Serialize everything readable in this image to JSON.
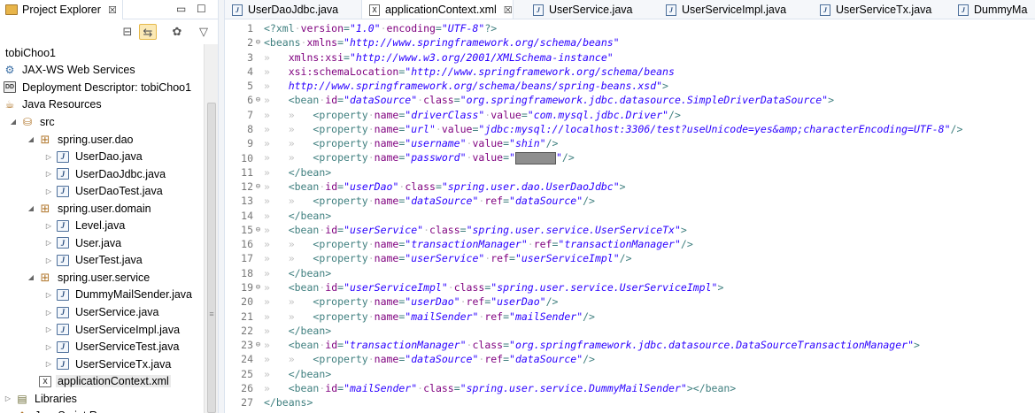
{
  "explorer": {
    "title": "Project Explorer",
    "close_glyph": "☒",
    "minimize_glyph": "▭",
    "maximize_glyph": "☐",
    "toolbar": {
      "collapse_all_glyph": "⊟",
      "link_editor_glyph": "⇆",
      "focus_glyph": "✿",
      "view_menu_glyph": "▽"
    },
    "tree": [
      {
        "label": "tobiChoo1",
        "depth": 0,
        "twisty": "",
        "icon": "project-icon"
      },
      {
        "label": "JAX-WS Web Services",
        "depth": 0,
        "twisty": "",
        "icon": "web-services-icon"
      },
      {
        "label": "Deployment Descriptor: tobiChoo1",
        "depth": 0,
        "twisty": "",
        "icon": "deployment-descriptor-icon"
      },
      {
        "label": "Java Resources",
        "depth": 0,
        "twisty": "",
        "icon": "java-resources-icon"
      },
      {
        "label": "src",
        "depth": 1,
        "twisty": "◢",
        "icon": "source-folder-icon"
      },
      {
        "label": "spring.user.dao",
        "depth": 2,
        "twisty": "◢",
        "icon": "package-icon"
      },
      {
        "label": "UserDao.java",
        "depth": 3,
        "twisty": "▷",
        "icon": "java-file-icon"
      },
      {
        "label": "UserDaoJdbc.java",
        "depth": 3,
        "twisty": "▷",
        "icon": "java-file-icon"
      },
      {
        "label": "UserDaoTest.java",
        "depth": 3,
        "twisty": "▷",
        "icon": "java-file-icon"
      },
      {
        "label": "spring.user.domain",
        "depth": 2,
        "twisty": "◢",
        "icon": "package-icon"
      },
      {
        "label": "Level.java",
        "depth": 3,
        "twisty": "▷",
        "icon": "java-file-icon"
      },
      {
        "label": "User.java",
        "depth": 3,
        "twisty": "▷",
        "icon": "java-file-icon"
      },
      {
        "label": "UserTest.java",
        "depth": 3,
        "twisty": "▷",
        "icon": "java-file-icon"
      },
      {
        "label": "spring.user.service",
        "depth": 2,
        "twisty": "◢",
        "icon": "package-icon"
      },
      {
        "label": "DummyMailSender.java",
        "depth": 3,
        "twisty": "▷",
        "icon": "java-file-icon"
      },
      {
        "label": "UserService.java",
        "depth": 3,
        "twisty": "▷",
        "icon": "java-file-icon"
      },
      {
        "label": "UserServiceImpl.java",
        "depth": 3,
        "twisty": "▷",
        "icon": "java-file-icon"
      },
      {
        "label": "UserServiceTest.java",
        "depth": 3,
        "twisty": "▷",
        "icon": "java-file-icon"
      },
      {
        "label": "UserServiceTx.java",
        "depth": 3,
        "twisty": "▷",
        "icon": "java-file-icon"
      },
      {
        "label": "applicationContext.xml",
        "depth": 2,
        "twisty": "",
        "icon": "xml-file-icon",
        "selected": true
      },
      {
        "label": "Libraries",
        "depth": 0,
        "twisty": "▷",
        "icon": "libraries-icon"
      },
      {
        "label": "JavaScript Resources",
        "depth": 0,
        "twisty": "▷",
        "icon": "javascript-resources-icon"
      }
    ]
  },
  "editor": {
    "tabs": [
      {
        "label": "UserDaoJdbc.java",
        "type": "java"
      },
      {
        "label": "applicationContext.xml",
        "type": "xml",
        "active": true,
        "close": "☒"
      },
      {
        "label": "UserService.java",
        "type": "java"
      },
      {
        "label": "UserServiceImpl.java",
        "type": "java"
      },
      {
        "label": "UserServiceTx.java",
        "type": "java"
      },
      {
        "label": "DummyMa",
        "type": "java"
      }
    ],
    "lines": [
      {
        "n": "1",
        "fold": "",
        "tokens": [
          [
            "t",
            "<?xml"
          ],
          [
            "ws",
            "·"
          ],
          [
            "a",
            "version"
          ],
          [
            "t",
            "="
          ],
          [
            "v",
            "\"1.0\""
          ],
          [
            "ws",
            "·"
          ],
          [
            "a",
            "encoding"
          ],
          [
            "t",
            "="
          ],
          [
            "v",
            "\"UTF-8\""
          ],
          [
            "t",
            "?>"
          ]
        ]
      },
      {
        "n": "2",
        "fold": "⊖",
        "tokens": [
          [
            "t",
            "<beans"
          ],
          [
            "ws",
            "·"
          ],
          [
            "a",
            "xmlns"
          ],
          [
            "t",
            "="
          ],
          [
            "v",
            "\"http://www.springframework.org/schema/beans\""
          ]
        ]
      },
      {
        "n": "3",
        "fold": "",
        "tokens": [
          [
            "ws",
            "»   "
          ],
          [
            "a",
            "xmlns:xsi"
          ],
          [
            "t",
            "="
          ],
          [
            "v",
            "\"http://www.w3.org/2001/XMLSchema-instance\""
          ]
        ]
      },
      {
        "n": "4",
        "fold": "",
        "tokens": [
          [
            "ws",
            "»   "
          ],
          [
            "a",
            "xsi:schemaLocation"
          ],
          [
            "t",
            "="
          ],
          [
            "v",
            "\"http://www.springframework.org/schema/beans"
          ]
        ]
      },
      {
        "n": "5",
        "fold": "",
        "tokens": [
          [
            "ws",
            "»   "
          ],
          [
            "v",
            "http://www.springframework.org/schema/beans/spring-beans.xsd\""
          ],
          [
            "t",
            ">"
          ]
        ]
      },
      {
        "n": "6",
        "fold": "⊖",
        "tokens": [
          [
            "ws",
            "»   "
          ],
          [
            "t",
            "<bean"
          ],
          [
            "ws",
            "·"
          ],
          [
            "a",
            "id"
          ],
          [
            "t",
            "="
          ],
          [
            "v",
            "\"dataSource\""
          ],
          [
            "ws",
            "·"
          ],
          [
            "a",
            "class"
          ],
          [
            "t",
            "="
          ],
          [
            "v",
            "\"org.springframework.jdbc.datasource.SimpleDriverDataSource\""
          ],
          [
            "t",
            ">"
          ]
        ]
      },
      {
        "n": "7",
        "fold": "",
        "tokens": [
          [
            "ws",
            "»   »   "
          ],
          [
            "t",
            "<property"
          ],
          [
            "ws",
            "·"
          ],
          [
            "a",
            "name"
          ],
          [
            "t",
            "="
          ],
          [
            "v",
            "\"driverClass\""
          ],
          [
            "ws",
            "·"
          ],
          [
            "a",
            "value"
          ],
          [
            "t",
            "="
          ],
          [
            "v",
            "\"com.mysql.jdbc.Driver\""
          ],
          [
            "t",
            "/>"
          ]
        ]
      },
      {
        "n": "8",
        "fold": "",
        "tokens": [
          [
            "ws",
            "»   »   "
          ],
          [
            "t",
            "<property"
          ],
          [
            "ws",
            "·"
          ],
          [
            "a",
            "name"
          ],
          [
            "t",
            "="
          ],
          [
            "v",
            "\"url\""
          ],
          [
            "ws",
            "·"
          ],
          [
            "a",
            "value"
          ],
          [
            "t",
            "="
          ],
          [
            "v",
            "\"jdbc:mysql://localhost:3306/test?useUnicode=yes&amp;characterEncoding=UTF-8\""
          ],
          [
            "t",
            "/>"
          ]
        ]
      },
      {
        "n": "9",
        "fold": "",
        "tokens": [
          [
            "ws",
            "»   »   "
          ],
          [
            "t",
            "<property"
          ],
          [
            "ws",
            "·"
          ],
          [
            "a",
            "name"
          ],
          [
            "t",
            "="
          ],
          [
            "v",
            "\"username\""
          ],
          [
            "ws",
            "·"
          ],
          [
            "a",
            "value"
          ],
          [
            "t",
            "="
          ],
          [
            "v",
            "\"shin\""
          ],
          [
            "t",
            "/>"
          ]
        ]
      },
      {
        "n": "10",
        "fold": "",
        "tokens": [
          [
            "ws",
            "»   »   "
          ],
          [
            "t",
            "<property"
          ],
          [
            "ws",
            "·"
          ],
          [
            "a",
            "name"
          ],
          [
            "t",
            "="
          ],
          [
            "v",
            "\"password\""
          ],
          [
            "ws",
            "·"
          ],
          [
            "a",
            "value"
          ],
          [
            "t",
            "="
          ],
          [
            "v",
            "\""
          ],
          [
            "redact",
            ""
          ],
          [
            "v",
            "\""
          ],
          [
            "t",
            "/>"
          ]
        ]
      },
      {
        "n": "11",
        "fold": "",
        "tokens": [
          [
            "ws",
            "»   "
          ],
          [
            "t",
            "</bean>"
          ]
        ]
      },
      {
        "n": "12",
        "fold": "⊖",
        "tokens": [
          [
            "ws",
            "»   "
          ],
          [
            "t",
            "<bean"
          ],
          [
            "ws",
            "·"
          ],
          [
            "a",
            "id"
          ],
          [
            "t",
            "="
          ],
          [
            "v",
            "\"userDao\""
          ],
          [
            "ws",
            "·"
          ],
          [
            "a",
            "class"
          ],
          [
            "t",
            "="
          ],
          [
            "v",
            "\"spring.user.dao.UserDaoJdbc\""
          ],
          [
            "t",
            ">"
          ]
        ]
      },
      {
        "n": "13",
        "fold": "",
        "tokens": [
          [
            "ws",
            "»   »   "
          ],
          [
            "t",
            "<property"
          ],
          [
            "ws",
            "·"
          ],
          [
            "a",
            "name"
          ],
          [
            "t",
            "="
          ],
          [
            "v",
            "\"dataSource\""
          ],
          [
            "ws",
            "·"
          ],
          [
            "a",
            "ref"
          ],
          [
            "t",
            "="
          ],
          [
            "v",
            "\"dataSource\""
          ],
          [
            "t",
            "/>"
          ]
        ]
      },
      {
        "n": "14",
        "fold": "",
        "tokens": [
          [
            "ws",
            "»   "
          ],
          [
            "t",
            "</bean>"
          ]
        ]
      },
      {
        "n": "15",
        "fold": "⊖",
        "tokens": [
          [
            "ws",
            "»   "
          ],
          [
            "t",
            "<bean"
          ],
          [
            "ws",
            "·"
          ],
          [
            "a",
            "id"
          ],
          [
            "t",
            "="
          ],
          [
            "v",
            "\"userService\""
          ],
          [
            "ws",
            "·"
          ],
          [
            "a",
            "class"
          ],
          [
            "t",
            "="
          ],
          [
            "v",
            "\"spring.user.service.UserServiceTx\""
          ],
          [
            "t",
            ">"
          ]
        ]
      },
      {
        "n": "16",
        "fold": "",
        "tokens": [
          [
            "ws",
            "»   »   "
          ],
          [
            "t",
            "<property"
          ],
          [
            "ws",
            "·"
          ],
          [
            "a",
            "name"
          ],
          [
            "t",
            "="
          ],
          [
            "v",
            "\"transactionManager\""
          ],
          [
            "ws",
            "·"
          ],
          [
            "a",
            "ref"
          ],
          [
            "t",
            "="
          ],
          [
            "v",
            "\"transactionManager\""
          ],
          [
            "t",
            "/>"
          ]
        ]
      },
      {
        "n": "17",
        "fold": "",
        "tokens": [
          [
            "ws",
            "»   »   "
          ],
          [
            "t",
            "<property"
          ],
          [
            "ws",
            "·"
          ],
          [
            "a",
            "name"
          ],
          [
            "t",
            "="
          ],
          [
            "v",
            "\"userService\""
          ],
          [
            "ws",
            "·"
          ],
          [
            "a",
            "ref"
          ],
          [
            "t",
            "="
          ],
          [
            "v",
            "\"userServiceImpl\""
          ],
          [
            "t",
            "/>"
          ]
        ]
      },
      {
        "n": "18",
        "fold": "",
        "tokens": [
          [
            "ws",
            "»   "
          ],
          [
            "t",
            "</bean>"
          ]
        ]
      },
      {
        "n": "19",
        "fold": "⊖",
        "tokens": [
          [
            "ws",
            "»   "
          ],
          [
            "t",
            "<bean"
          ],
          [
            "ws",
            "·"
          ],
          [
            "a",
            "id"
          ],
          [
            "t",
            "="
          ],
          [
            "v",
            "\"userServiceImpl\""
          ],
          [
            "ws",
            "·"
          ],
          [
            "a",
            "class"
          ],
          [
            "t",
            "="
          ],
          [
            "v",
            "\"spring.user.service.UserServiceImpl\""
          ],
          [
            "t",
            ">"
          ]
        ]
      },
      {
        "n": "20",
        "fold": "",
        "tokens": [
          [
            "ws",
            "»   »   "
          ],
          [
            "t",
            "<property"
          ],
          [
            "ws",
            "·"
          ],
          [
            "a",
            "name"
          ],
          [
            "t",
            "="
          ],
          [
            "v",
            "\"userDao\""
          ],
          [
            "ws",
            "·"
          ],
          [
            "a",
            "ref"
          ],
          [
            "t",
            "="
          ],
          [
            "v",
            "\"userDao\""
          ],
          [
            "t",
            "/>"
          ]
        ]
      },
      {
        "n": "21",
        "fold": "",
        "tokens": [
          [
            "ws",
            "»   »   "
          ],
          [
            "t",
            "<property"
          ],
          [
            "ws",
            "·"
          ],
          [
            "a",
            "name"
          ],
          [
            "t",
            "="
          ],
          [
            "v",
            "\"mailSender\""
          ],
          [
            "ws",
            "·"
          ],
          [
            "a",
            "ref"
          ],
          [
            "t",
            "="
          ],
          [
            "v",
            "\"mailSender\""
          ],
          [
            "t",
            "/>"
          ]
        ]
      },
      {
        "n": "22",
        "fold": "",
        "tokens": [
          [
            "ws",
            "»   "
          ],
          [
            "t",
            "</bean>"
          ]
        ]
      },
      {
        "n": "23",
        "fold": "⊖",
        "tokens": [
          [
            "ws",
            "»   "
          ],
          [
            "t",
            "<bean"
          ],
          [
            "ws",
            "·"
          ],
          [
            "a",
            "id"
          ],
          [
            "t",
            "="
          ],
          [
            "v",
            "\"transactionManager\""
          ],
          [
            "ws",
            "·"
          ],
          [
            "a",
            "class"
          ],
          [
            "t",
            "="
          ],
          [
            "v",
            "\"org.springframework.jdbc.datasource.DataSourceTransactionManager\""
          ],
          [
            "t",
            ">"
          ]
        ]
      },
      {
        "n": "24",
        "fold": "",
        "tokens": [
          [
            "ws",
            "»   »   "
          ],
          [
            "t",
            "<property"
          ],
          [
            "ws",
            "·"
          ],
          [
            "a",
            "name"
          ],
          [
            "t",
            "="
          ],
          [
            "v",
            "\"dataSource\""
          ],
          [
            "ws",
            "·"
          ],
          [
            "a",
            "ref"
          ],
          [
            "t",
            "="
          ],
          [
            "v",
            "\"dataSource\""
          ],
          [
            "t",
            "/>"
          ]
        ]
      },
      {
        "n": "25",
        "fold": "",
        "tokens": [
          [
            "ws",
            "»   "
          ],
          [
            "t",
            "</bean>"
          ]
        ]
      },
      {
        "n": "26",
        "fold": "",
        "tokens": [
          [
            "ws",
            "»   "
          ],
          [
            "t",
            "<bean"
          ],
          [
            "ws",
            "·"
          ],
          [
            "a",
            "id"
          ],
          [
            "t",
            "="
          ],
          [
            "v",
            "\"mailSender\""
          ],
          [
            "ws",
            "·"
          ],
          [
            "a",
            "class"
          ],
          [
            "t",
            "="
          ],
          [
            "v",
            "\"spring.user.service.DummyMailSender\""
          ],
          [
            "t",
            "></bean>"
          ]
        ]
      },
      {
        "n": "27",
        "fold": "",
        "tokens": [
          [
            "t",
            "</beans>"
          ]
        ]
      }
    ]
  }
}
